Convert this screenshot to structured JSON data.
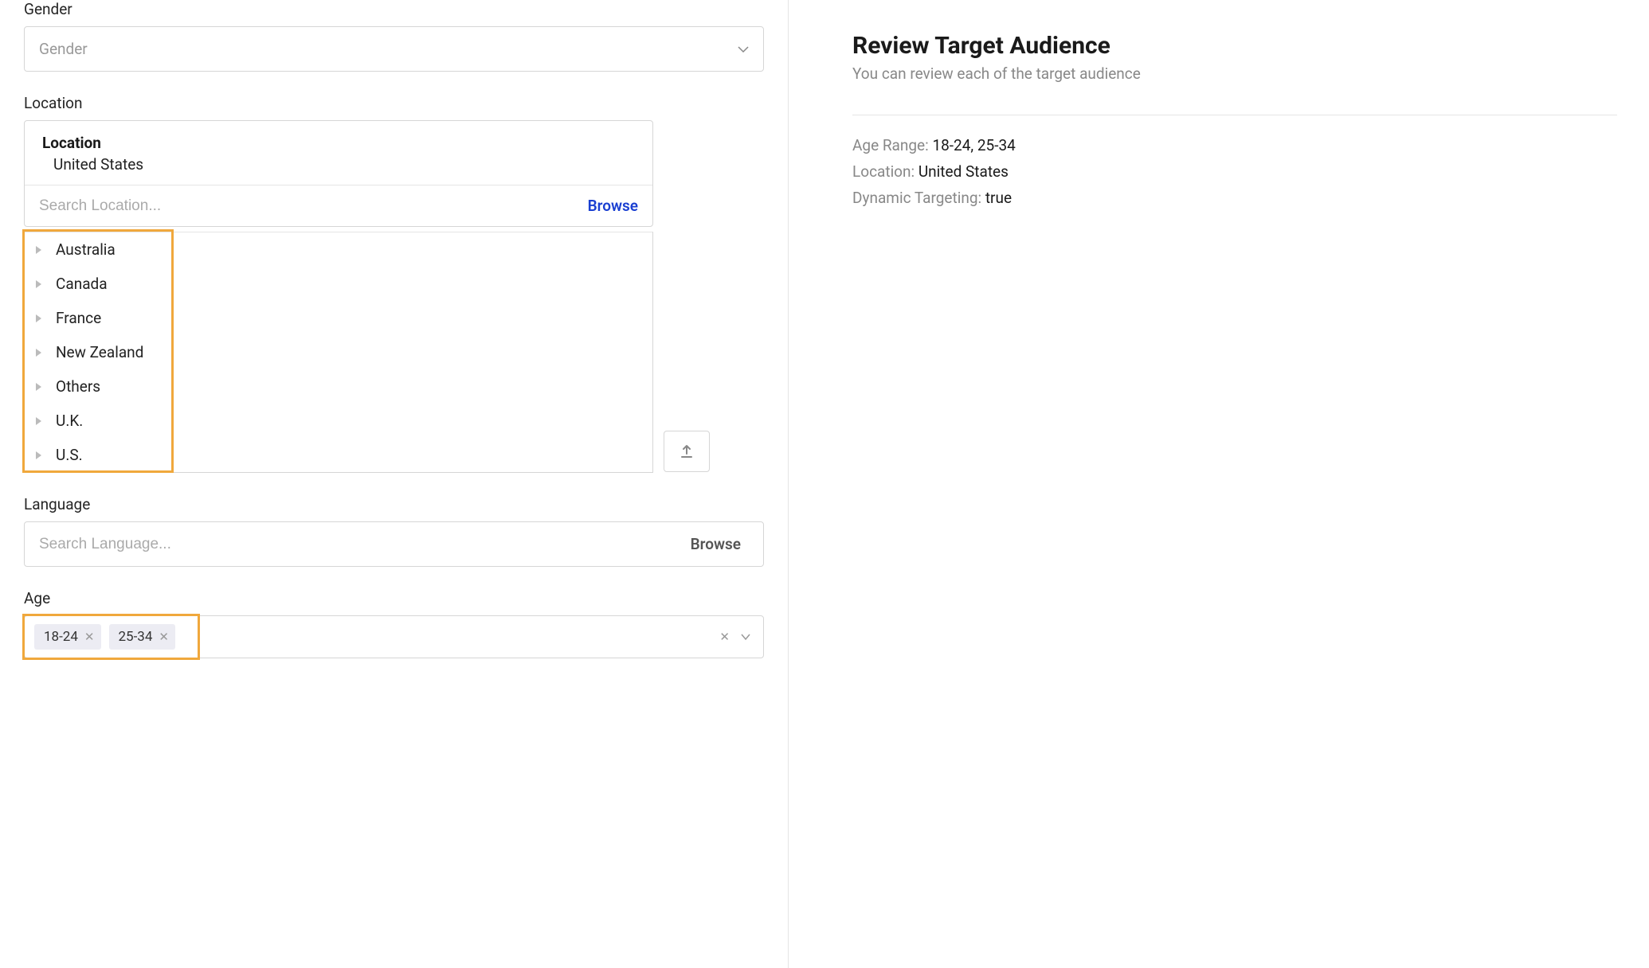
{
  "gender": {
    "label": "Gender",
    "placeholder": "Gender"
  },
  "location": {
    "label": "Location",
    "panel_title": "Location",
    "selected_value": "United States",
    "search_placeholder": "Search Location...",
    "browse_label": "Browse",
    "options": [
      "Australia",
      "Canada",
      "France",
      "New Zealand",
      "Others",
      "U.K.",
      "U.S."
    ]
  },
  "language": {
    "label": "Language",
    "search_placeholder": "Search Language...",
    "browse_label": "Browse"
  },
  "age": {
    "label": "Age",
    "tags": [
      "18-24",
      "25-34"
    ]
  },
  "review": {
    "title": "Review Target Audience",
    "subtitle": "You can review each of the target audience",
    "lines": {
      "age_range_label": "Age Range:",
      "age_range_value": "18-24, 25-34",
      "location_label": "Location:",
      "location_value": "United States",
      "dynamic_label": "Dynamic Targeting:",
      "dynamic_value": "true"
    }
  }
}
